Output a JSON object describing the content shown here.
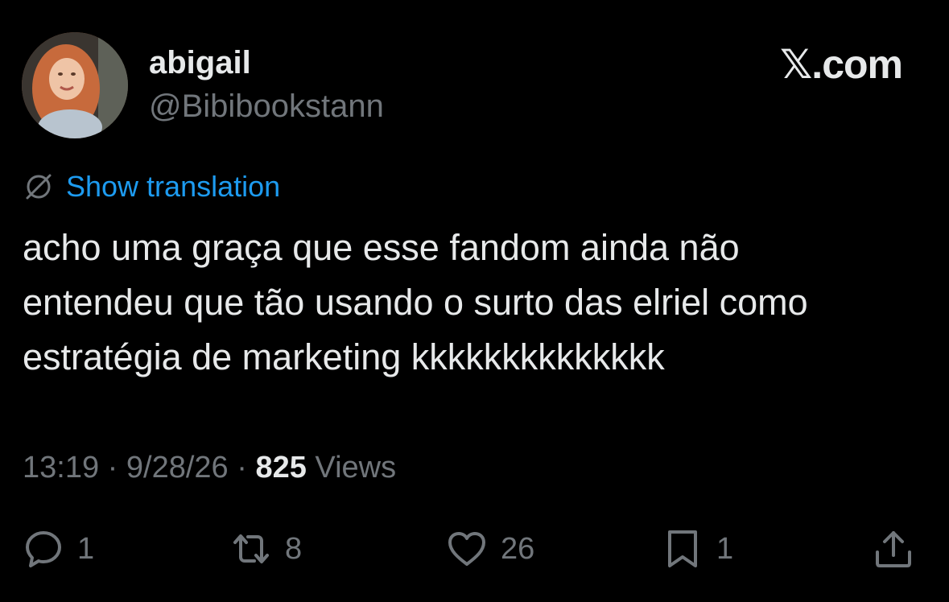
{
  "user": {
    "display_name": "abigail",
    "handle": "@Bibibookstann",
    "avatar_icon": "profile-photo"
  },
  "brand": {
    "label": "𝕏.com"
  },
  "translation": {
    "label": "Show translation",
    "icon": "globe-slash-icon",
    "color": "#1d9bf0"
  },
  "tweet": {
    "text": "acho uma graça que esse fandom ainda não\nentendeu que tão usando o surto das elriel como\nestratégia de marketing kkkkkkkkkkkkkk"
  },
  "meta": {
    "time": "13:19",
    "sep1": " · ",
    "date": "9/28/26",
    "sep2": " · ",
    "views_count": "825",
    "views_label": " Views"
  },
  "actions": {
    "reply": {
      "icon": "reply-icon",
      "count": "1"
    },
    "retweet": {
      "icon": "retweet-icon",
      "count": "8"
    },
    "like": {
      "icon": "heart-icon",
      "count": "26"
    },
    "bookmark": {
      "icon": "bookmark-icon",
      "count": "1"
    },
    "share": {
      "icon": "share-icon"
    }
  },
  "colors": {
    "background": "#000000",
    "primary_text": "#e7e9ea",
    "secondary_text": "#71767b",
    "link": "#1d9bf0"
  }
}
